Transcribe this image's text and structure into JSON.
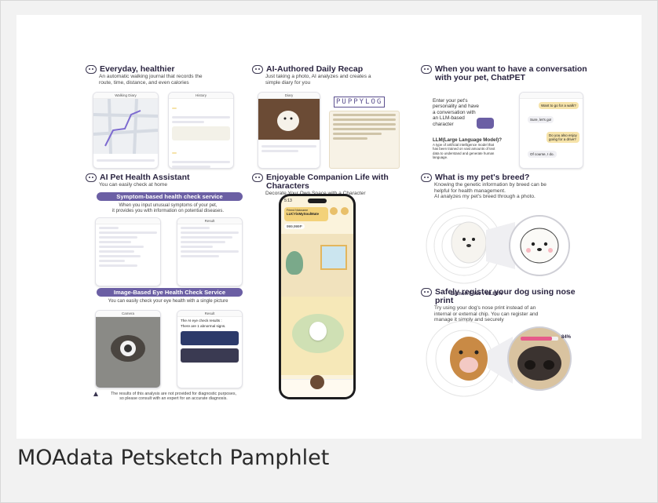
{
  "caption": "MOAdata Petsketch Pamphlet",
  "colors": {
    "accent": "#6b5fa4",
    "highlight": "#f6e3a9",
    "dark": "#2a2440"
  },
  "sections": {
    "walking": {
      "title": "Everyday, healthier",
      "desc1": "An automatic walking journal that records the",
      "desc2": "route, time, distance, and even calories",
      "screen_a": "Walking Diary",
      "screen_b": "History"
    },
    "recap": {
      "title": "AI-Authored Daily Recap",
      "desc1": "Just taking a photo, AI analyzes and creates a",
      "desc2": "simple diary for you",
      "screen": "Diary",
      "logo": "PUPPYLOG"
    },
    "chat": {
      "title1": "When you want to have a conversation",
      "title2": "with your pet, ChatPET",
      "body": [
        "Enter your pet's",
        "personality and have",
        "a conversation with",
        "an LLM-based",
        "character"
      ],
      "llm_title": "LLM(Large Language Model)?",
      "llm_desc": [
        "A type of artificial intelligence model that",
        "has been trained on vast amounts of text",
        "data to understand and generate human",
        "language."
      ],
      "bubbles": [
        "Want to go for a walk?",
        "Sure, let's go!",
        "Do you also enjoy going for a drive?",
        "Of course, I do."
      ]
    },
    "health": {
      "title": "AI Pet Health Assistant",
      "sub": "You can easily check at home",
      "pill1": "Symptom-based health check service",
      "desc1": "When you input unusual symptoms of your pet,",
      "desc2": "it provides you with information on potential diseases.",
      "screen": "Result",
      "pill2": "Image-Based Eye Health Check Service",
      "desc3": "You can easily check your eye health with a single picture",
      "screen_cam": "Camera",
      "screen_res": "Result",
      "res_line1": "The AI eye check results :",
      "res_line2": "There are 1 abnormal signs.",
      "warn1": "The results of this analysis are not provided for diagnostic purposes,",
      "warn2": "so please consult with an expert for an accurate diagnosis."
    },
    "companion": {
      "title": "Enjoyable Companion Life with Characters",
      "sub": "Decorate Your Own Space with a Character",
      "time": "5:13",
      "friend_label": "Friend Nickname",
      "friend_name": "LUCYisMySoulMate",
      "coins": "999,999P"
    },
    "breed": {
      "title": "What is my pet's breed?",
      "desc": [
        "Knowing the genetic information by breed can be",
        "helpful for health management.",
        "AI analyzes my pet's breed through a photo."
      ],
      "result": "Bichon Frise : 98.88%"
    },
    "nose": {
      "title": "Safely register your dog using nose print",
      "desc": [
        "Try using your dog's nose print instead of an",
        "internal or external chip. You can register and",
        "manage it simply and securely"
      ],
      "percent": "84%"
    }
  }
}
